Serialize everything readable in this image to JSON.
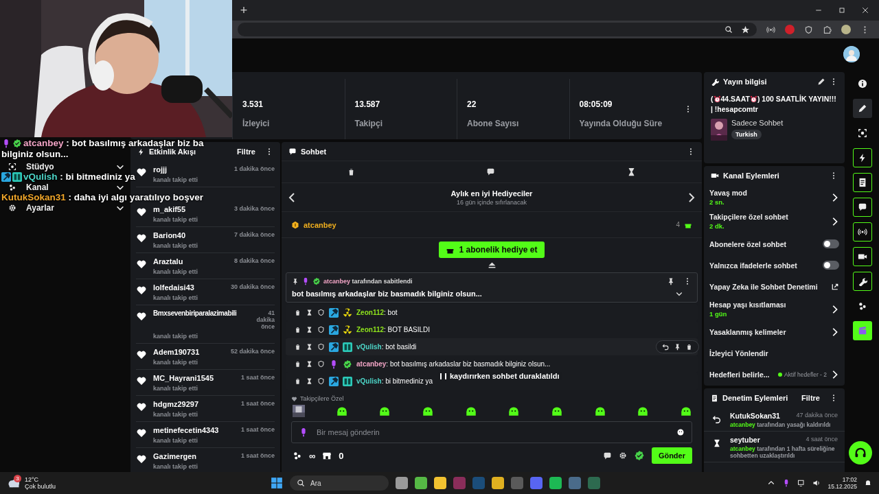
{
  "browser": {
    "new_tab": "+"
  },
  "overlay_chat": [
    {
      "kind": "owner",
      "user": "atcanbey",
      "color": "#f2a5c6",
      "text": " : bot basılmış arkadaşlar biz ba",
      "continuation": "bilginiz olsun..."
    },
    {
      "kind": "mod_sub",
      "user": "vQulish",
      "color": "#4dd6c8",
      "text": " : bi bitmediniz ya"
    },
    {
      "kind": "none",
      "user": "KutukSokan31",
      "color": "#f2a72a",
      "text": " : daha iyi algı yaratılıyo boşver"
    }
  ],
  "sidebar": {
    "items": [
      {
        "label": "Stüdyo"
      },
      {
        "label": "Kanal"
      },
      {
        "label": "Ayarlar"
      }
    ]
  },
  "stats": [
    {
      "value": "3.531",
      "label": "İzleyici"
    },
    {
      "value": "13.587",
      "label": "Takipçi"
    },
    {
      "value": "22",
      "label": "Abone Sayısı"
    },
    {
      "value": "08:05:09",
      "label": "Yayında Olduğu Süre"
    }
  ],
  "activity": {
    "title": "Etkinlik Akışı",
    "filter": "Filtre",
    "events": [
      {
        "user": "rojjj",
        "time": "1 dakika önce",
        "action": "kanalı takip etti"
      },
      {
        "user": "m_akif55",
        "time": "3 dakika önce",
        "action": "kanalı takip etti"
      },
      {
        "user": "Barion40",
        "time": "7 dakika önce",
        "action": "kanalı takip etti"
      },
      {
        "user": "Araztalu",
        "time": "8 dakika önce",
        "action": "kanalı takip etti"
      },
      {
        "user": "lolfedaisi43",
        "time": "30 dakika önce",
        "action": "kanalı takip etti"
      },
      {
        "user": "Bmxsevenbiriparalazimabili",
        "time": "41 dakika önce",
        "action": "kanalı takip etti"
      },
      {
        "user": "Adem190731",
        "time": "52 dakika önce",
        "action": "kanalı takip etti"
      },
      {
        "user": "MC_Hayrani1545",
        "time": "1 saat önce",
        "action": "kanalı takip etti"
      },
      {
        "user": "hdgmz29297",
        "time": "1 saat önce",
        "action": "kanalı takip etti"
      },
      {
        "user": "metinefecetin4343",
        "time": "1 saat önce",
        "action": "kanalı takip etti"
      },
      {
        "user": "Gazimergen",
        "time": "1 saat önce",
        "action": "kanalı takip etti"
      }
    ]
  },
  "chat": {
    "title": "Sohbet",
    "leaderboard": {
      "title": "Aylık en iyi Hediyeciler",
      "subtitle": "16 gün içinde sıfırlanacak",
      "leader": {
        "name": "atcanbey",
        "count": "4"
      }
    },
    "gift_button": "1 abonelik hediye et",
    "pinned": {
      "user": "atcanbey",
      "suffix": " tarafından sabitlendi",
      "text": "bot basılmış arkadaşlar biz basmadık bilginiz olsun..."
    },
    "messages": [
      {
        "kind": "mod_radiant",
        "user": "Zeon112",
        "color": "#8ee21c",
        "text": ": bot",
        "highlighted": false
      },
      {
        "kind": "mod_radiant",
        "user": "Zeon112",
        "color": "#8ee21c",
        "text": ": BOT BASILDI",
        "highlighted": false
      },
      {
        "kind": "mod_sub",
        "user": "vQulish",
        "color": "#4dd6c8",
        "text": ": bot basildi",
        "highlighted": true
      },
      {
        "kind": "owner",
        "user": "atcanbey",
        "color": "#f2a5c6",
        "text": ": bot basılmış arkadaslar biz basmadık bilginiz olsun...",
        "highlighted": false
      },
      {
        "kind": "mod_sub",
        "user": "vQulish",
        "color": "#4dd6c8",
        "text": ": bi bitmediniz ya",
        "highlighted": false
      }
    ],
    "paused_notice": "kaydırırken sohbet duraklatıldı",
    "emote_section": "Takipçilere Özel",
    "input": {
      "placeholder": "Bir mesaj gönderin"
    },
    "points": "∞",
    "shop_count": "0",
    "send": "Gönder"
  },
  "stream_info": {
    "title": "Yayın bilgisi",
    "stream_title": [
      "(",
      "44.SAAT",
      ") 100 SAATLİK YAYIN!!! | !hesapcomtr"
    ],
    "category": "Sadece Sohbet",
    "tag": "Turkish"
  },
  "channel_actions": {
    "title": "Kanal Eylemleri",
    "items": [
      {
        "kind": "link",
        "label": "Yavaş mod",
        "value": "2 sn."
      },
      {
        "kind": "link",
        "label": "Takipçilere özel sohbet",
        "value": "2 dk."
      },
      {
        "kind": "toggle",
        "label": "Abonelere özel sohbet",
        "on": false
      },
      {
        "kind": "toggle",
        "label": "Yalnızca ifadelerle sohbet",
        "on": false
      },
      {
        "kind": "external",
        "label": "Yapay Zeka ile Sohbet Denetimi"
      },
      {
        "kind": "link",
        "label": "Hesap yaşı kısıtlaması",
        "value": "1 gün"
      },
      {
        "kind": "link",
        "label": "Yasaklanmış kelimeler"
      },
      {
        "kind": "plain",
        "label": "İzleyici Yönlendir"
      },
      {
        "kind": "link",
        "label": "Hedefleri belirle...",
        "status": "Aktif hedefler - 2"
      }
    ]
  },
  "mod_actions": {
    "title": "Denetim Eylemleri",
    "filter": "Filtre",
    "entries": [
      {
        "kind": "unban",
        "user": "KutukSokan31",
        "time": "47 dakika önce",
        "actor": "atcanbey",
        "action": " tarafından yasağı kaldırıldı"
      },
      {
        "kind": "timeout",
        "user": "seytuber",
        "time": "4 saat önce",
        "actor": "atcanbey",
        "action": " tarafından 1 hafta süreliğine sohbetten uzaklaştırıldı"
      }
    ]
  },
  "rail": [
    {
      "kind": "plain"
    },
    {
      "kind": "raised"
    },
    {
      "kind": "plain"
    },
    {
      "kind": "boxed"
    },
    {
      "kind": "boxed"
    },
    {
      "kind": "boxed"
    },
    {
      "kind": "boxed"
    },
    {
      "kind": "boxed"
    },
    {
      "kind": "boxed"
    },
    {
      "kind": "plain"
    },
    {
      "kind": "filled"
    }
  ],
  "taskbar": {
    "weather": {
      "badge": "3",
      "temp": "12°C",
      "desc": "Çok bulutlu"
    },
    "search": "Ara",
    "time": "17:02",
    "date": "15.12.2025"
  }
}
